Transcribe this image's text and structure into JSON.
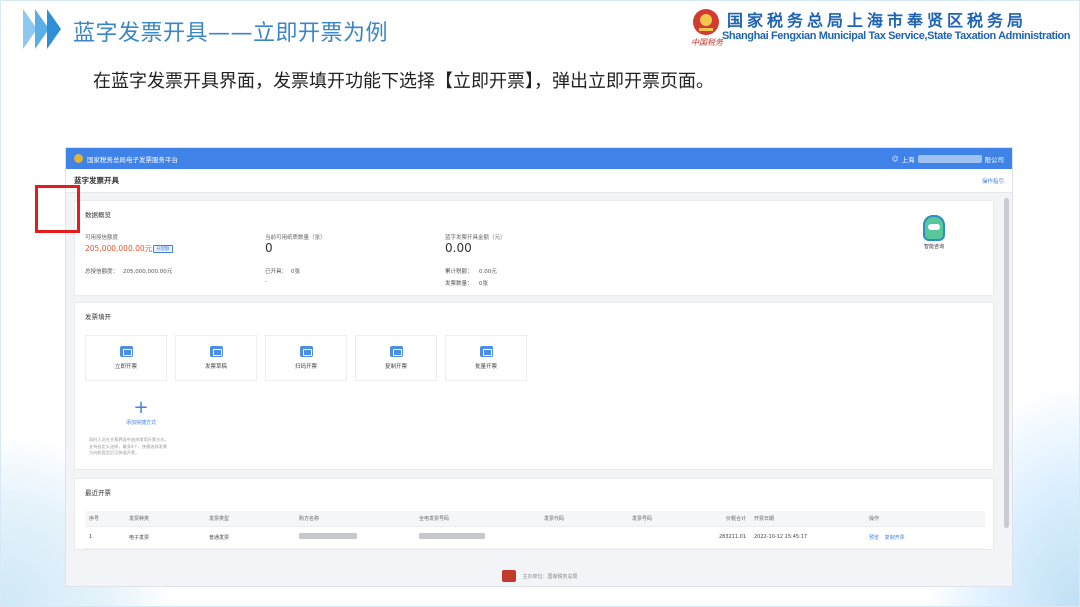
{
  "slide": {
    "title": "蓝字发票开具——立即开票为例",
    "instruction": "在蓝字发票开具界面，发票填开功能下选择【立即开票】，弹出立即开票页面。"
  },
  "org": {
    "name_cn": "国家税务总局上海市奉贤区税务局",
    "name_en": "Shanghai Fengxian Municipal Tax Service,State Taxation Administration",
    "seal_text": "中国税务"
  },
  "app": {
    "platform_title": "国家税务总局电子发票服务平台",
    "user_prefix": "上海",
    "company_suffix": "限公司",
    "page_title": "蓝字发票开具",
    "guide_link": "操作指引"
  },
  "overview": {
    "title": "数据概览",
    "credit_label": "可用授信额度",
    "credit_value": "205,000,000.00元",
    "credit_pill": "分配额",
    "total_credit_label": "总授信额度：",
    "total_credit_value": "205,000,000.00元",
    "available_count_label": "当前可用纸质数量（张）",
    "available_count_value": "0",
    "issued_label": "已开具：",
    "issued_value": "0张",
    "issued_dash": "-",
    "blue_amount_label": "蓝字发票开具金额（元）",
    "blue_amount_value": "0.00",
    "cum_tax_label": "累计税额：",
    "cum_tax_value": "0.00元",
    "invoice_count_label": "发票数量：",
    "invoice_count_value": "0张"
  },
  "issue": {
    "title": "发票填开",
    "cards": [
      {
        "label": "立即开票"
      },
      {
        "label": "发票草稿"
      },
      {
        "label": "扫码开票"
      },
      {
        "label": "复制开票"
      },
      {
        "label": "批量开票"
      }
    ],
    "add_label": "添加快捷方式",
    "add_desc": "同时人员在开票界面中选择常用开票方式，支持自定义选择，最多4个，快捷选择发票方向和类型后可快速开票。"
  },
  "recent": {
    "title": "最近开票",
    "headers": [
      "序号",
      "发票种类",
      "发票类型",
      "购方名称",
      "全电发票号码",
      "发票代码",
      "发票号码",
      "价税合计",
      "开票日期",
      "操作"
    ],
    "rows": [
      {
        "index": "1",
        "kind": "电子发票",
        "type": "普通发票",
        "total": "283211.01",
        "date": "2022-10-12 15:45:17",
        "op1": "预览",
        "op2": "复制开票"
      }
    ]
  },
  "assistant": {
    "label": "智能咨询"
  },
  "footer": {
    "text": "主办单位：国家税务总局"
  }
}
